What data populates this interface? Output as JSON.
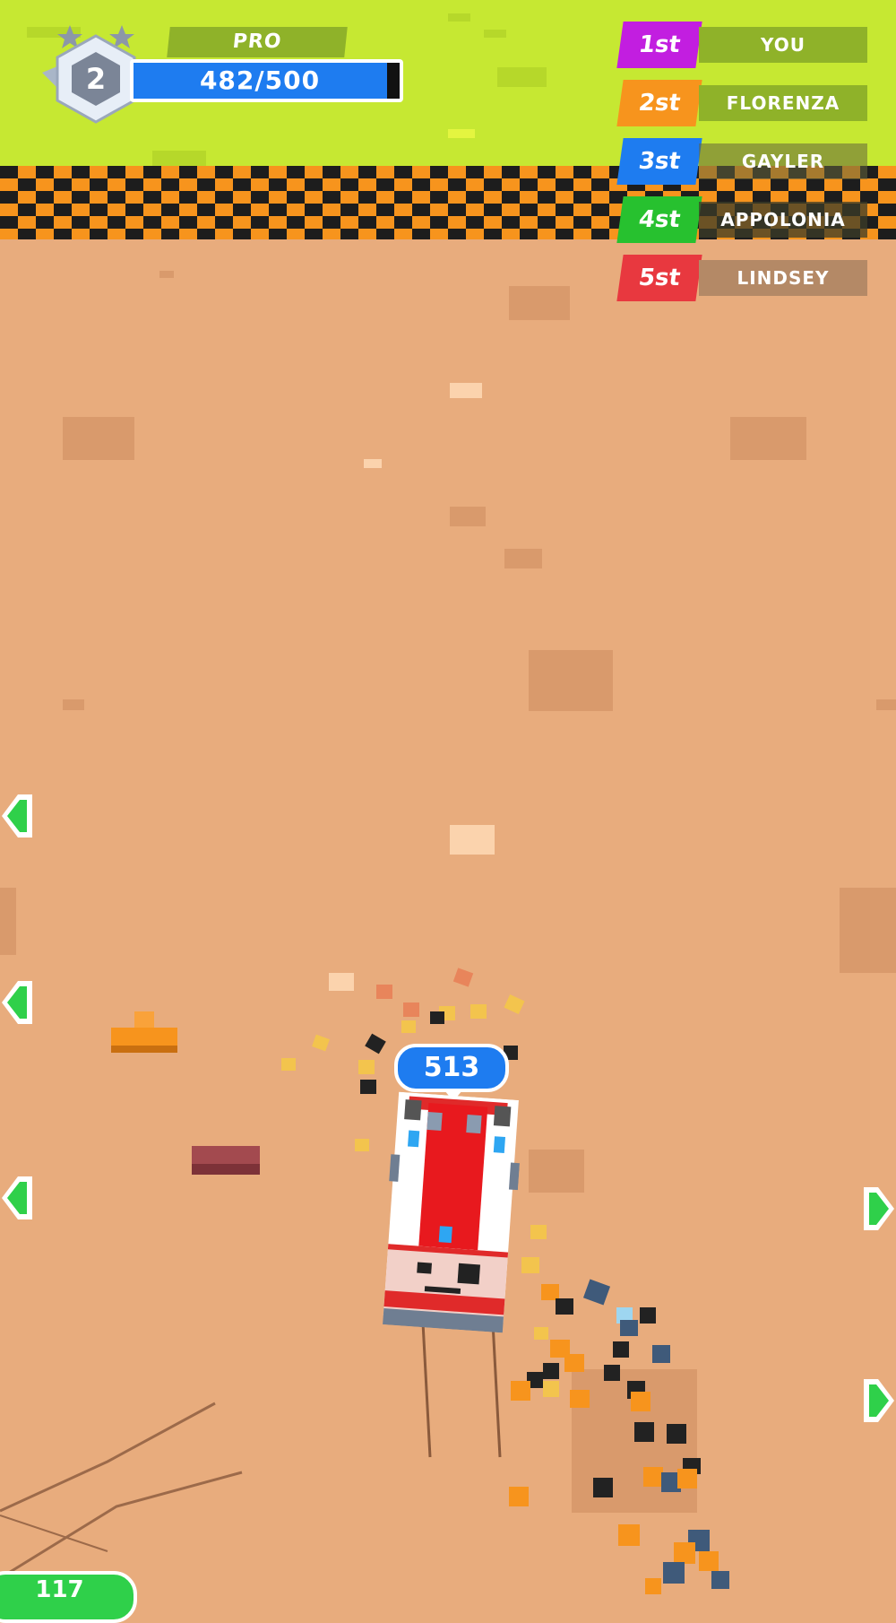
{
  "player": {
    "level": "2",
    "rank_label": "PRO",
    "xp_text": "482/500",
    "xp_progress": 0.964
  },
  "leaderboard": [
    {
      "position": "1st",
      "name": "YOU",
      "color": "#c21ee0"
    },
    {
      "position": "2st",
      "name": "FLORENZA",
      "color": "#f7941d"
    },
    {
      "position": "3st",
      "name": "GAYLER",
      "color": "#1e7cf0"
    },
    {
      "position": "4st",
      "name": "APPOLONIA",
      "color": "#27c12f"
    },
    {
      "position": "5st",
      "name": "LINDSEY",
      "color": "#e8383f"
    }
  ],
  "car": {
    "score": "513"
  },
  "bottom_counter": {
    "value": "117"
  },
  "colors": {
    "grass": "#c6e832",
    "dirt": "#e8ac7d",
    "arrow": "#2fd04a",
    "badge_blue": "#1e7cf0"
  }
}
